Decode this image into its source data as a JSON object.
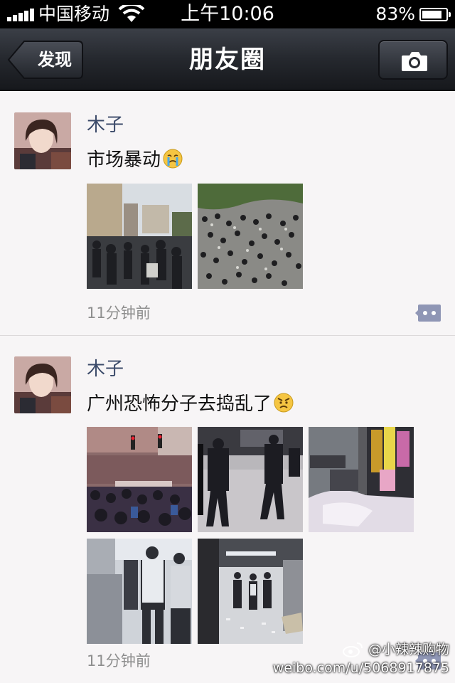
{
  "status_bar": {
    "carrier": "中国移动",
    "time": "上午10:06",
    "battery_percent": "83%",
    "battery_level": 0.83,
    "icons": [
      "signal-icon",
      "wifi-icon",
      "battery-icon"
    ]
  },
  "nav": {
    "back_label": "发现",
    "title": "朋友圈",
    "right_icon": "camera-icon"
  },
  "posts": [
    {
      "author": "木子",
      "text": "市场暴动",
      "emoji": "crying-face-emoji",
      "photos": [
        "crowd-street-photo",
        "crowd-aerial-photo"
      ],
      "time": "11分钟前",
      "action_icon": "comment-icon"
    },
    {
      "author": "木子",
      "text": "广州恐怖分子去捣乱了",
      "emoji": "angry-face-emoji",
      "photos": [
        "crowd-intersection-photo",
        "police-street-photo",
        "market-stalls-photo",
        "market-corridor-photo",
        "mall-floor-photo"
      ],
      "time": "11分钟前",
      "action_icon": "comment-icon"
    }
  ],
  "watermark": {
    "handle": "@小辣辣购物",
    "url": "weibo.com/u/5068917875",
    "icon": "weibo-logo-icon"
  },
  "colors": {
    "nav_bar": "#25282e",
    "author_name": "#3c4b6a",
    "timestamp": "#8e8e8e",
    "feed_bg": "#f7f5f6"
  }
}
